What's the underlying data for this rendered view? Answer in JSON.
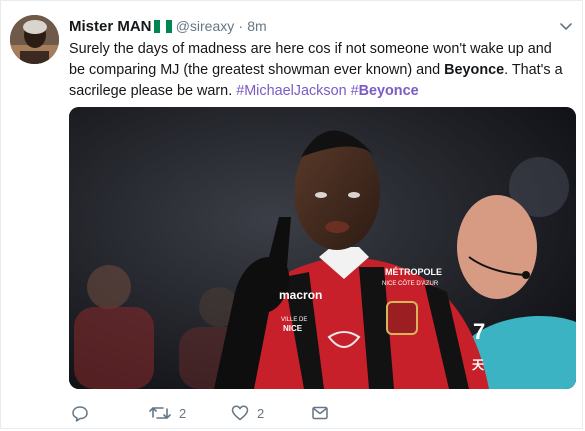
{
  "tweet": {
    "author_name": "Mister MAN",
    "handle": "@sireaxy",
    "separator": "·",
    "time": "8m",
    "text_1": "Surely the days of madness are here cos if not someone won't wake up and be comparing MJ (the greatest showman ever known) and ",
    "bold_1": "Beyonce",
    "text_2": ". That's a sacrilege please be warn. ",
    "hashtag_1": "#MichaelJackson",
    "text_3": " ",
    "hashtag_2_prefix": "#",
    "hashtag_2_bold": "Beyonce",
    "retweet_count": "2",
    "like_count": "2",
    "link_color": "#7a5bc5",
    "icons": [
      "reply-icon",
      "retweet-icon",
      "like-icon",
      "message-icon",
      "caret-down-icon"
    ],
    "flag_colors": [
      "#008751",
      "#ffffff",
      "#008751"
    ],
    "photo_text": {
      "sponsor": "macron",
      "chest_1": "MÉTROPOLE",
      "chest_2": "NICE CÔTE D'AZUR",
      "logo_1": "VILLE DE",
      "logo_2": "NICE",
      "sleeve": "7",
      "sleeve_2": "天"
    }
  }
}
